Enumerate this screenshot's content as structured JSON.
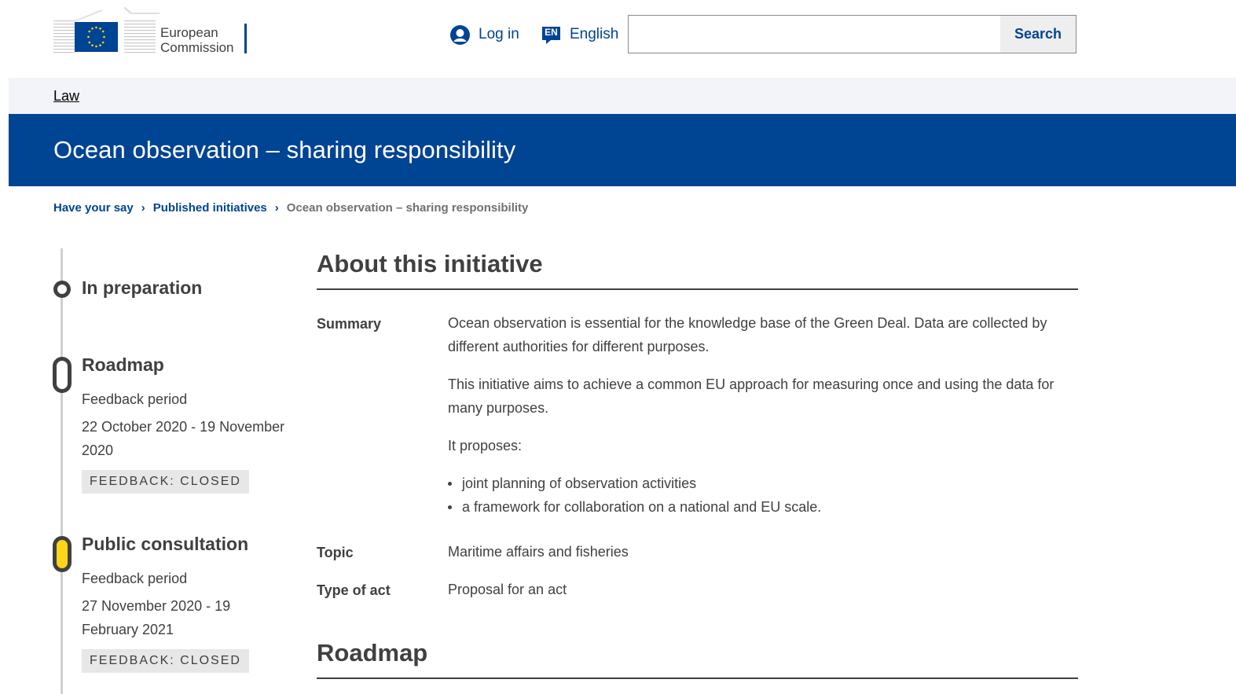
{
  "header": {
    "logo_line1": "European",
    "logo_line2": "Commission",
    "login_label": "Log in",
    "language_code": "EN",
    "language_label": "English",
    "search_placeholder": "",
    "search_button": "Search"
  },
  "site_nav": {
    "link": "Law"
  },
  "page_title": "Ocean observation – sharing responsibility",
  "breadcrumb": {
    "items": [
      "Have your say",
      "Published initiatives"
    ],
    "current": "Ocean observation – sharing responsibility"
  },
  "timeline": {
    "stages": [
      {
        "title": "In preparation"
      },
      {
        "title": "Roadmap",
        "period_label": "Feedback period",
        "dates": "22 October 2020 - 19 November 2020",
        "status": "FEEDBACK: CLOSED"
      },
      {
        "title": "Public consultation",
        "period_label": "Feedback period",
        "dates": "27 November 2020 - 19 February 2021",
        "status": "FEEDBACK: CLOSED"
      }
    ]
  },
  "about": {
    "title": "About this initiative",
    "summary_label": "Summary",
    "summary_p1": "Ocean observation is essential for the knowledge base of the Green Deal. Data are collected by different authorities for different purposes.",
    "summary_p2": "This initiative aims to achieve a common EU approach for measuring once and using the data for many purposes.",
    "summary_p3": "It proposes:",
    "summary_bullets": [
      "joint planning of observation activities",
      "a framework for collaboration on a national and EU scale."
    ],
    "topic_label": "Topic",
    "topic_value": "Maritime affairs and fisheries",
    "type_label": "Type of act",
    "type_value": "Proposal for an act"
  },
  "roadmap_section": {
    "title": "Roadmap"
  },
  "colors": {
    "brand_blue": "#004494",
    "eu_yellow": "#ffd617",
    "text": "#404040",
    "sitebar_bg": "#f2f4f9",
    "badge_bg": "#e7e7e7"
  }
}
